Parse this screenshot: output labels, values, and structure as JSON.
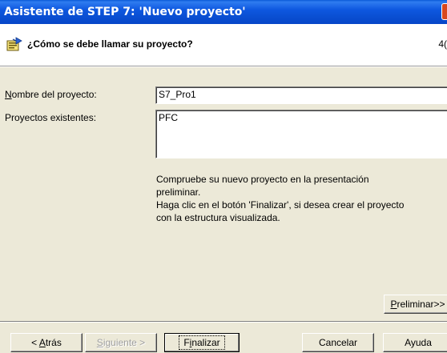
{
  "window": {
    "title": "Asistente de STEP 7: 'Nuevo proyecto'"
  },
  "header": {
    "question": "¿Cómo se debe llamar su proyecto?",
    "step": "4("
  },
  "form": {
    "name_label_accel": "N",
    "name_label_rest": "ombre del proyecto:",
    "name_value": "S7_Pro1",
    "existing_label": "Proyectos existentes:",
    "existing_projects": [
      "PFC"
    ]
  },
  "info": {
    "line1": "Compruebe su nuevo proyecto en la presentación",
    "line2": "preliminar.",
    "line3": "Haga clic en el botón 'Finalizar', si desea crear el proyecto",
    "line4": "con la estructura visualizada."
  },
  "buttons": {
    "preview_accel": "P",
    "preview_rest": "reliminar>>",
    "back_prefix": "< ",
    "back_accel": "A",
    "back_rest": "trás",
    "next_accel": "S",
    "next_rest": "iguiente >",
    "finish_pre": "F",
    "finish_accel": "i",
    "finish_rest": "nalizar",
    "cancel": "Cancelar",
    "help": "Ayuda"
  },
  "icons": {
    "wizard": "wizard-icon",
    "close": "close-icon"
  }
}
